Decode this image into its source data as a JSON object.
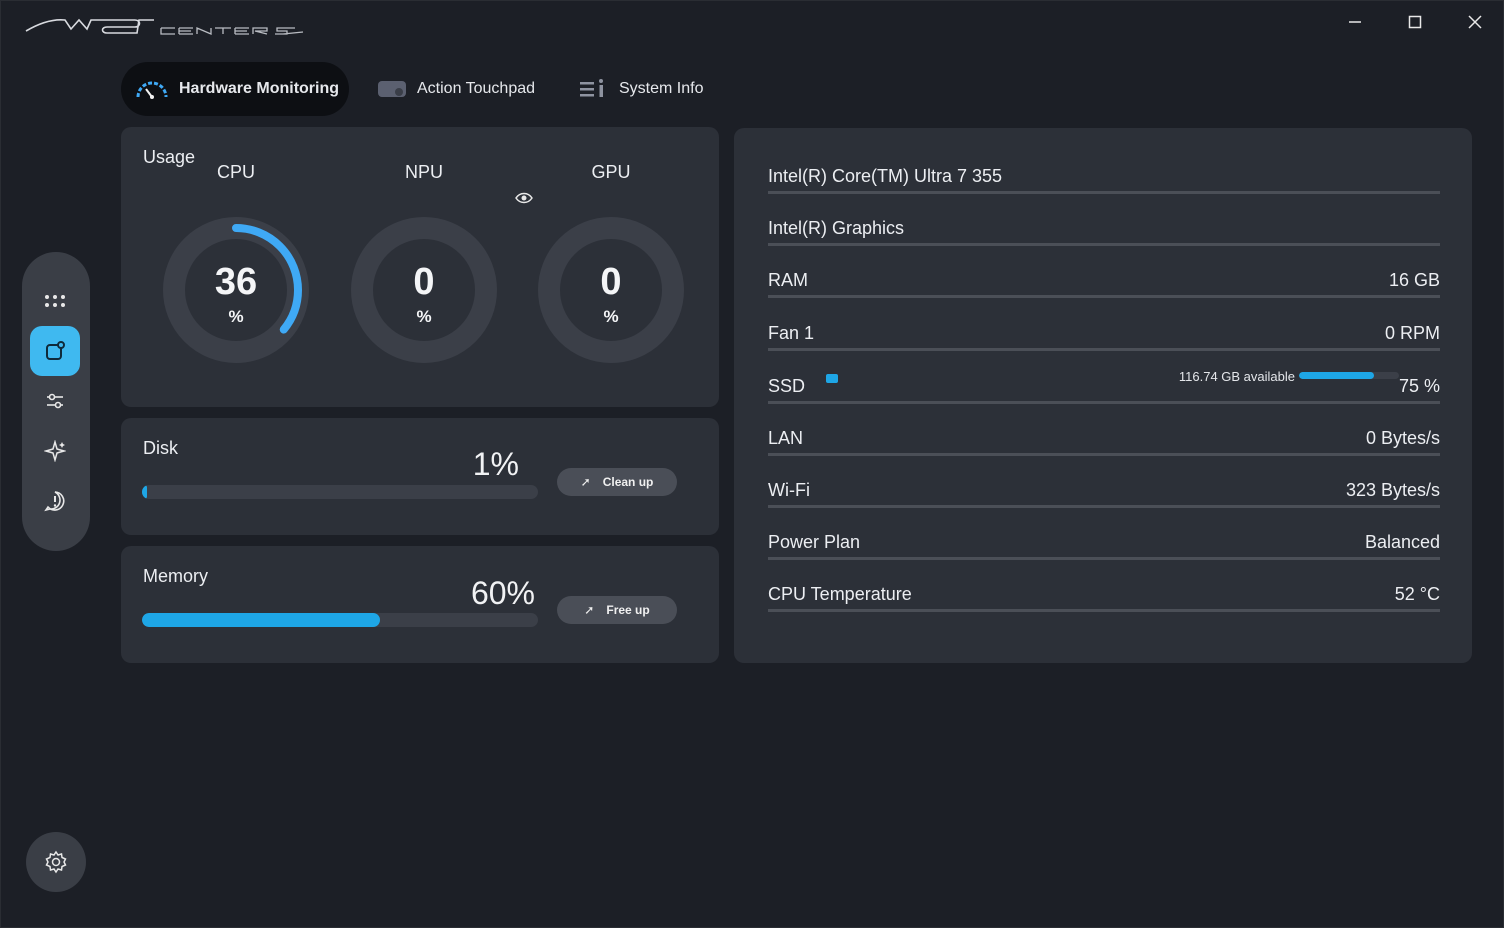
{
  "app": {
    "logo_text": "MSI CENTER S"
  },
  "window_controls": {
    "minimize": "—",
    "maximize": "☐",
    "close": "✕"
  },
  "tabs": [
    {
      "label": "Hardware Monitoring",
      "icon": "speedometer-icon",
      "active": true
    },
    {
      "label": "Action Touchpad",
      "icon": "touchpad-icon",
      "active": false
    },
    {
      "label": "System Info",
      "icon": "system-info-icon",
      "active": false
    }
  ],
  "sidenav": {
    "items": [
      {
        "icon": "apps-grid-icon",
        "active": false
      },
      {
        "icon": "feature-icon",
        "active": true
      },
      {
        "icon": "sliders-icon",
        "active": false
      },
      {
        "icon": "sparkle-icon",
        "active": false
      },
      {
        "icon": "support-icon",
        "active": false
      }
    ],
    "settings_icon": "gear-icon"
  },
  "usage": {
    "title": "Usage",
    "accent": "#3fa9f5",
    "gauges": [
      {
        "label": "CPU",
        "value": "36",
        "unit": "%",
        "fraction": 0.36
      },
      {
        "label": "NPU",
        "value": "0",
        "unit": "%",
        "fraction": 0
      },
      {
        "label": "GPU",
        "value": "0",
        "unit": "%",
        "fraction": 0
      }
    ],
    "eye_icon": "eye-icon"
  },
  "disk": {
    "title": "Disk",
    "percent_text": "1%",
    "fraction": 0.01,
    "button_label": "Clean up"
  },
  "memory": {
    "title": "Memory",
    "percent_text": "60%",
    "fraction": 0.6,
    "button_label": "Free up"
  },
  "info": {
    "rows": [
      {
        "key": "Intel(R) Core(TM) Ultra 7 355",
        "value": ""
      },
      {
        "key": "Intel(R) Graphics",
        "value": ""
      },
      {
        "key": "RAM",
        "value": "16 GB"
      },
      {
        "key": "Fan 1",
        "value": "0 RPM"
      },
      {
        "key": "SSD",
        "value": "75 %"
      },
      {
        "key": "LAN",
        "value": "0 Bytes/s"
      },
      {
        "key": "Wi-Fi",
        "value": "323 Bytes/s"
      },
      {
        "key": "Power Plan",
        "value": "Balanced"
      },
      {
        "key": "CPU Temperature",
        "value": "52 °C"
      }
    ],
    "ssd_available": "116.74  GB available",
    "ssd_fraction": 0.75
  }
}
